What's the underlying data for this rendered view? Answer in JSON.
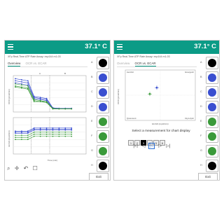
{
  "temperature": "37.1° C",
  "assay_title": "XFp Real-Time ATP Rate Assay: exp144 m1-03",
  "tabs": [
    "Overview",
    "OCR vs. ECAR"
  ],
  "wells": [
    "A",
    "B",
    "C",
    "D",
    "E",
    "F",
    "G",
    "H"
  ],
  "well_colors": [
    "#000000",
    "#3a4fd0",
    "#3a4fd0",
    "#3a4fd0",
    "#3a9a3a",
    "#3a9a3a",
    "#3a9a3a",
    "#000000"
  ],
  "exit_label": "Exit",
  "left_panel": {
    "active_tab": 0,
    "ocr_ylabel": "OCR (pmol/min)",
    "ecar_ylabel": "ECAR (mpH/min)",
    "xlabel": "Time (min)",
    "injection_labels": [
      "A",
      "B"
    ],
    "tool_icons": [
      "zoom-in-icon",
      "pan-move-icon",
      "undo-icon",
      "reset-zoom-icon"
    ]
  },
  "right_panel": {
    "active_tab": 1,
    "quadrant_labels": [
      "Aerobic",
      "Energetic",
      "Quiescent",
      "Glycolytic"
    ],
    "xlabel": "ECAR (mpH/min)",
    "ylabel": "OCR (pmol/min)",
    "select_label": "Select a measurement for chart display",
    "measurements": [
      "1",
      "2",
      "3",
      "4",
      "5",
      "6"
    ],
    "selected_measurement": 2,
    "nav_icons": [
      "first-icon",
      "previous-icon",
      "play-icon",
      "next-icon",
      "last-icon"
    ]
  },
  "chart_data": [
    {
      "type": "line",
      "xlabel": "Time (min)",
      "ylabel": "OCR (pmol/min)",
      "xlim": [
        0,
        70
      ],
      "ylim": [
        0,
        35
      ],
      "x": [
        2,
        8,
        14,
        20,
        26,
        32,
        38,
        44,
        50,
        56
      ],
      "series": [
        {
          "color": "#3a4fd0",
          "values": [
            32,
            31,
            30,
            15,
            14,
            13,
            4,
            3.5,
            3.5,
            3.5
          ]
        },
        {
          "color": "#3a4fd0",
          "values": [
            30,
            29,
            28,
            14,
            13,
            12,
            4,
            3.5,
            3.5,
            3.5
          ]
        },
        {
          "color": "#3a4fd0",
          "values": [
            28,
            27,
            26,
            13,
            12,
            11,
            3.5,
            3,
            3,
            3
          ]
        },
        {
          "color": "#3a9a3a",
          "values": [
            27,
            26,
            25,
            12,
            11,
            10,
            3.5,
            3,
            3,
            3
          ]
        },
        {
          "color": "#3a9a3a",
          "values": [
            25,
            24,
            23,
            11,
            10,
            10,
            3,
            3,
            3,
            3
          ]
        },
        {
          "color": "#3a9a3a",
          "values": [
            24,
            23,
            22,
            10,
            10,
            9,
            3,
            3,
            3,
            3
          ]
        }
      ]
    },
    {
      "type": "line",
      "xlabel": "Time (min)",
      "ylabel": "ECAR (mpH/min)",
      "xlim": [
        0,
        70
      ],
      "ylim": [
        0,
        35
      ],
      "x": [
        2,
        8,
        14,
        20,
        26,
        32,
        38,
        44,
        50,
        56
      ],
      "series": [
        {
          "color": "#3a4fd0",
          "values": [
            22,
            22,
            22,
            25,
            25,
            25,
            25,
            25,
            25,
            25
          ]
        },
        {
          "color": "#3a4fd0",
          "values": [
            21,
            21,
            21,
            24,
            24,
            24,
            24,
            24,
            24,
            24
          ]
        },
        {
          "color": "#3a4fd0",
          "values": [
            20,
            20,
            20,
            23,
            23,
            23,
            23,
            23,
            23,
            23
          ]
        },
        {
          "color": "#3a9a3a",
          "values": [
            18,
            18,
            18,
            21,
            21,
            21,
            21,
            21,
            21,
            21
          ]
        },
        {
          "color": "#3a9a3a",
          "values": [
            16,
            16,
            16,
            19,
            19,
            19,
            19,
            19,
            19,
            19
          ]
        },
        {
          "color": "#3a9a3a",
          "values": [
            14,
            14,
            14,
            17,
            17,
            17,
            17,
            17,
            17,
            17
          ]
        }
      ]
    },
    {
      "type": "scatter",
      "xlabel": "ECAR (mpH/min)",
      "ylabel": "OCR (pmol/min)",
      "xlim": [
        0,
        40
      ],
      "ylim": [
        0,
        40
      ],
      "series": [
        {
          "color": "#3a4fd0",
          "values": [
            {
              "x": 18,
              "y": 26
            }
          ]
        },
        {
          "color": "#3a9a3a",
          "values": [
            {
              "x": 14,
              "y": 21
            }
          ]
        }
      ]
    }
  ]
}
